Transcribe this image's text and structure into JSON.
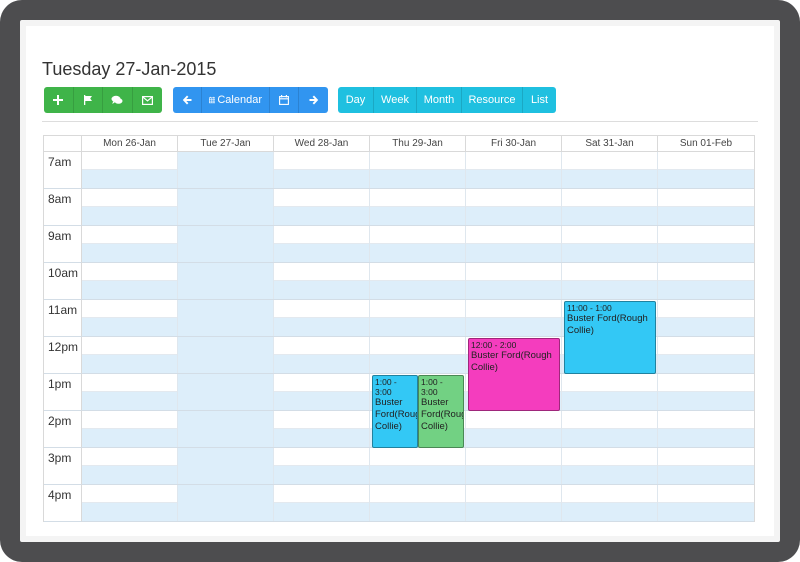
{
  "header": {
    "title": "Tuesday 27-Jan-2015"
  },
  "toolbar": {
    "green_icons": [
      "plus-icon",
      "flag-icon",
      "comments-icon",
      "envelope-icon"
    ],
    "blue": {
      "prev_icon": "arrow-left-icon",
      "calendar_label": "Calendar",
      "date_icon": "calendar-icon",
      "next_icon": "arrow-right-icon"
    },
    "views": [
      "Day",
      "Week",
      "Month",
      "Resource",
      "List"
    ]
  },
  "calendar": {
    "days": [
      "Mon 26-Jan",
      "Tue 27-Jan",
      "Wed 28-Jan",
      "Thu 29-Jan",
      "Fri 30-Jan",
      "Sat 31-Jan",
      "Sun 01-Feb"
    ],
    "today_index": 1,
    "hours": [
      "7am",
      "8am",
      "9am",
      "10am",
      "11am",
      "12pm",
      "1pm",
      "2pm",
      "3pm",
      "4pm"
    ],
    "events": [
      {
        "time": "1:00 - 3:00",
        "title": "Buster Ford(Rough Collie)",
        "color": "#33c8f5"
      },
      {
        "time": "1:00 - 3:00",
        "title": "Buster Ford(Rough Collie)",
        "color": "#72d183"
      },
      {
        "time": "12:00 - 2:00",
        "title": "Buster Ford(Rough Collie)",
        "color": "#f43dbe"
      },
      {
        "time": "11:00 - 1:00",
        "title": "Buster Ford(Rough Collie)",
        "color": "#33c8f5"
      }
    ]
  },
  "colors": {
    "green": "#3fb449",
    "blue": "#3195f0",
    "cyan": "#1fc0e0",
    "highlight": "#ddeefa"
  }
}
